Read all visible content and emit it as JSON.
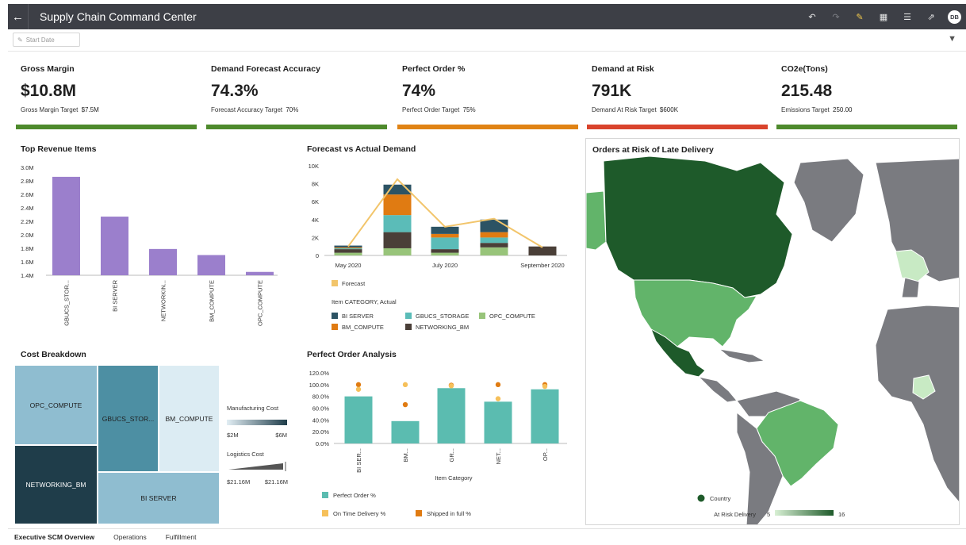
{
  "header": {
    "title": "Supply Chain Command Center",
    "back_icon": "back-arrow-icon",
    "toolbar": [
      "undo-icon",
      "redo-icon",
      "edit-icon",
      "present-icon",
      "comment-icon",
      "export-icon"
    ],
    "avatar_initials": "DB"
  },
  "filters": {
    "start_date_placeholder": "Start Date"
  },
  "kpis": [
    {
      "title": "Gross Margin",
      "value": "$10.8M",
      "target_label": "Gross Margin Target",
      "target_value": "$7.5M",
      "status_color": "#4e8a2c"
    },
    {
      "title": "Demand Forecast Accuracy",
      "value": "74.3%",
      "target_label": "Forecast Accuracy Target",
      "target_value": "70%",
      "status_color": "#4e8a2c"
    },
    {
      "title": "Perfect Order %",
      "value": "74%",
      "target_label": "Perfect Order Target",
      "target_value": "75%",
      "status_color": "#e08314"
    },
    {
      "title": "Demand at Risk",
      "value": "791K",
      "target_label": "Demand At Risk Target",
      "target_value": "$600K",
      "status_color": "#d9432c"
    },
    {
      "title": "CO2e(Tons)",
      "value": "215.48",
      "target_label": "Emissions Target",
      "target_value": "250.00",
      "status_color": "#4e8a2c"
    }
  ],
  "top_revenue": {
    "title": "Top Revenue Items"
  },
  "forecast_panel": {
    "title": "Forecast vs Actual Demand",
    "legend_forecast": "Forecast",
    "legend_group": "Item CATEGORY, Actual"
  },
  "cost_breakdown": {
    "title": "Cost Breakdown",
    "cells": [
      "OPC_COMPUTE",
      "GBUCS_STOR...",
      "BM_COMPUTE",
      "NETWORKING_BM",
      "BI SERVER"
    ],
    "legend_manufacturing": "Manufacturing Cost",
    "manufacturing_min": "$2M",
    "manufacturing_max": "$6M",
    "legend_logistics": "Logistics Cost",
    "logistics_min": "$21.16M",
    "logistics_max": "$21.16M"
  },
  "perfect_order": {
    "title": "Perfect Order Analysis",
    "xlabel": "Item Category",
    "legend_perfect": "Perfect Order %",
    "legend_ontime": "On Time Delivery %",
    "legend_shipped": "Shipped in full %"
  },
  "map_panel": {
    "title": "Orders at Risk of Late Delivery",
    "legend_country": "Country",
    "legend_scale_label": "At Risk Delivery",
    "scale_min": "5",
    "scale_max": "16",
    "colors": {
      "high": "#1e5a2a",
      "mid": "#62b46a",
      "low": "#c8eac4",
      "none": "#7a7b80"
    }
  },
  "tabs": [
    "Executive SCM Overview",
    "Operations",
    "Fulfillment"
  ],
  "chart_data": [
    {
      "type": "bar",
      "title": "Top Revenue Items",
      "categories": [
        "GBUCS_STOR...",
        "BI SERVER",
        "NETWORKIN...",
        "BM_COMPUTE",
        "OPC_COMPUTE"
      ],
      "values": [
        2.86,
        2.27,
        1.79,
        1.7,
        1.45
      ],
      "yticks": [
        "3.0M",
        "2.8M",
        "2.6M",
        "2.4M",
        "2.2M",
        "2.0M",
        "1.8M",
        "1.6M",
        "1.4M"
      ],
      "ylim": [
        1.4,
        3.0
      ],
      "color": "#9b7fcc"
    },
    {
      "type": "bar",
      "stacked": true,
      "title": "Forecast vs Actual Demand",
      "x": [
        "May 2020",
        "Jun 2020",
        "July 2020",
        "Aug 2020",
        "September 2020"
      ],
      "xticks": [
        "May 2020",
        "July 2020",
        "September 2020"
      ],
      "yticks": [
        "10K",
        "8K",
        "6K",
        "4K",
        "2K",
        "0"
      ],
      "ylim": [
        0,
        10000
      ],
      "series": [
        {
          "name": "OPC_COMPUTE",
          "color": "#98c47a",
          "values": [
            300,
            800,
            300,
            900,
            0
          ]
        },
        {
          "name": "NETWORKING_BM",
          "color": "#4a3f38",
          "values": [
            400,
            1800,
            400,
            500,
            1000
          ]
        },
        {
          "name": "GBUCS_STORAGE",
          "color": "#5bbcb8",
          "values": [
            100,
            1900,
            1300,
            600,
            0
          ]
        },
        {
          "name": "BM_COMPUTE",
          "color": "#e07b12",
          "values": [
            100,
            2300,
            400,
            600,
            0
          ]
        },
        {
          "name": "BI SERVER",
          "color": "#2c5364",
          "values": [
            200,
            1100,
            800,
            1400,
            0
          ]
        }
      ],
      "line": {
        "name": "Forecast",
        "color": "#f2c56b",
        "values": [
          1000,
          8500,
          3200,
          4100,
          900
        ]
      },
      "legend": [
        "BI SERVER",
        "GBUCS_STORAGE",
        "OPC_COMPUTE",
        "BM_COMPUTE",
        "NETWORKING_BM"
      ]
    },
    {
      "type": "bar",
      "title": "Perfect Order Analysis",
      "categories": [
        "BI SER...",
        "BM...",
        "GR...",
        "NET...",
        "OP..."
      ],
      "yticks": [
        "120.0%",
        "100.0%",
        "80.0%",
        "60.0%",
        "40.0%",
        "20.0%",
        "0.0%"
      ],
      "ylim": [
        0,
        120
      ],
      "xlabel": "Item Category",
      "series": [
        {
          "name": "Perfect Order %",
          "color": "#5bbcb0",
          "values": [
            80,
            38,
            94,
            71,
            92
          ]
        },
        {
          "name": "On Time Delivery %",
          "color": "#f6c05a",
          "values": [
            92,
            100,
            98,
            76,
            97
          ],
          "marker": "dot"
        },
        {
          "name": "Shipped in full %",
          "color": "#e07b12",
          "values": [
            100,
            66,
            99,
            100,
            100
          ],
          "marker": "dot"
        }
      ]
    }
  ]
}
